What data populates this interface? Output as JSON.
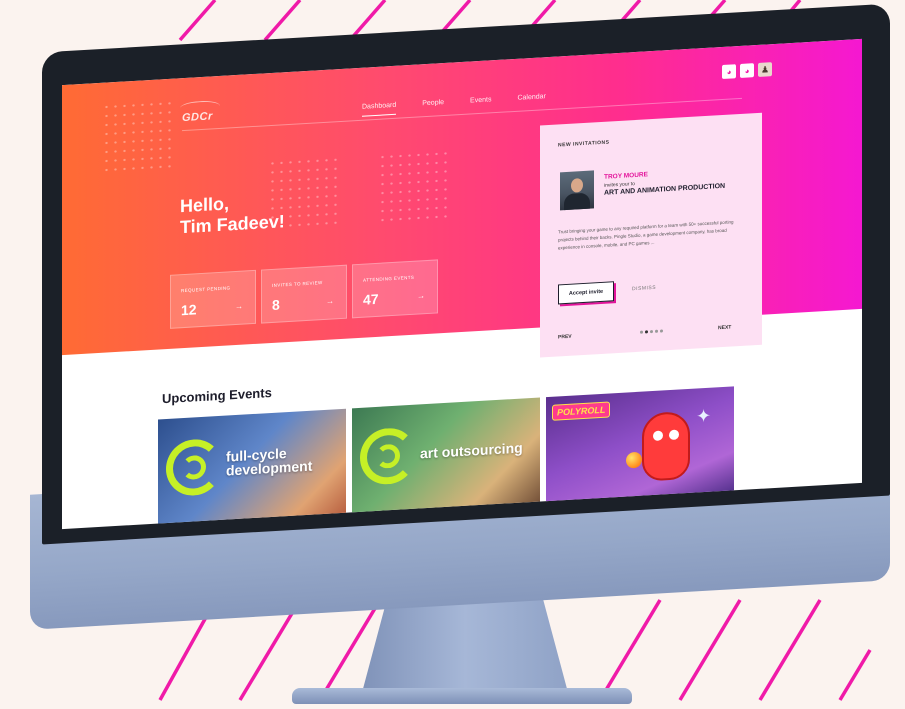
{
  "app": {
    "logo_text": "GDCr"
  },
  "nav": {
    "items": [
      {
        "label": "Dashboard",
        "active": true
      },
      {
        "label": "People",
        "active": false
      },
      {
        "label": "Events",
        "active": false
      },
      {
        "label": "Calendar",
        "active": false
      }
    ]
  },
  "top_icons": [
    {
      "icon": "chameleon-icon",
      "glyph": "◕"
    },
    {
      "icon": "chameleon-icon",
      "glyph": "◕"
    },
    {
      "icon": "user-avatar",
      "glyph": "♟"
    }
  ],
  "hero": {
    "greeting_line1": "Hello,",
    "greeting_line2": "Tim Fadeev!",
    "stats": [
      {
        "label": "REQUEST PENDING",
        "value": "12",
        "arrow": "→"
      },
      {
        "label": "INVITES TO REVIEW",
        "value": "8",
        "arrow": "→"
      },
      {
        "label": "ATTENDING EVENTS",
        "value": "47",
        "arrow": "→"
      }
    ]
  },
  "invitation": {
    "section_title": "NEW INVITATIONS",
    "inviter_name": "TROY MOURE",
    "invites_text": "invites your to",
    "project": "ART AND ANIMATION PRODUCTION",
    "description": "Trust bringing your game to any required platform for a team with 50+ successful porting projects behind their backs. Pingle Studio, a game development company, has broad experience in console, mobile, and PC games ...",
    "accept_label": "Accept invite",
    "dismiss_label": "DISMISS",
    "prev_label": "PREV",
    "next_label": "NEXT",
    "pager_count": 5,
    "pager_active": 1
  },
  "events": {
    "section_title": "Upcoming Events",
    "cards": [
      {
        "label_line1": "full-cycle",
        "label_line2": "development"
      },
      {
        "label_line1": "art outsourcing",
        "label_line2": ""
      },
      {
        "logo_text": "POLYROLL"
      }
    ]
  },
  "colors": {
    "accent_pink": "#e3149b",
    "hero_orange": "#ff6b34",
    "hero_magenta": "#f518d1",
    "card_bg": "#fde0f3",
    "lime": "#c6f026"
  }
}
